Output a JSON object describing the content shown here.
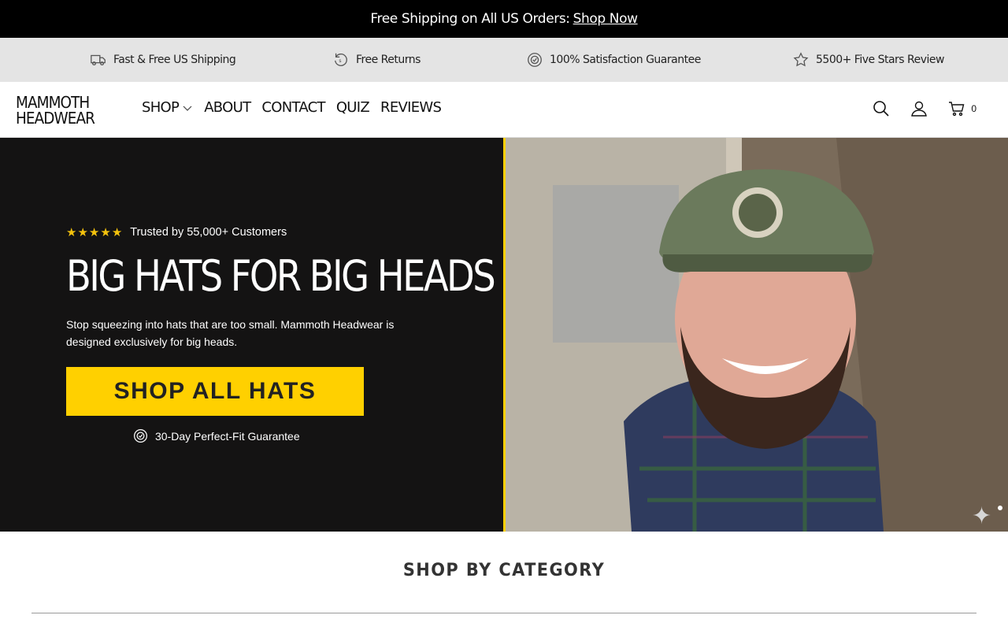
{
  "announcement": {
    "text": "Free Shipping on All US Orders:",
    "link": "Shop Now"
  },
  "perks": [
    {
      "icon": "truck-icon",
      "label": "Fast & Free US Shipping"
    },
    {
      "icon": "return-icon",
      "label": "Free Returns"
    },
    {
      "icon": "badge-check-icon",
      "label": "100% Satisfaction Guarantee"
    },
    {
      "icon": "star-outline-icon",
      "label": "5500+ Five Stars Review"
    }
  ],
  "header": {
    "logo_line1": "MAMMOTH",
    "logo_line2": "HEADWEAR",
    "nav": [
      "SHOP",
      "ABOUT",
      "CONTACT",
      "QUIZ",
      "REVIEWS"
    ],
    "cart_count": "0"
  },
  "hero": {
    "rating_text": "Trusted by 55,000+ Customers",
    "stars": 5,
    "headline": "BIG HATS FOR BIG HEADS",
    "subtext": "Stop squeezing into hats that are too small. Mammoth Headwear is designed exclusively for big heads.",
    "cta_label": "SHOP ALL HATS",
    "guarantee": "30-Day Perfect-Fit Guarantee"
  },
  "category": {
    "title": "SHOP BY CATEGORY"
  },
  "colors": {
    "accent": "#ffd000",
    "hero_bg": "#141313",
    "announce_bg": "#000000",
    "perks_bg": "#e4e4e4"
  }
}
